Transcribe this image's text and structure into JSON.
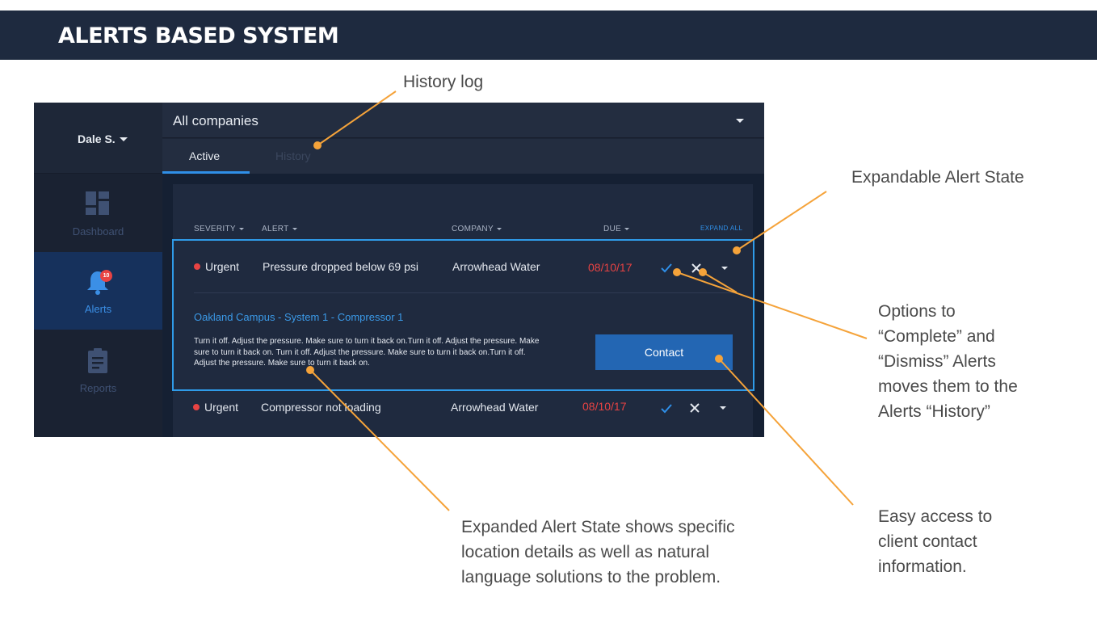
{
  "page_title": "ALERTS BASED SYSTEM",
  "app": {
    "user": {
      "name": "Dale S."
    },
    "nav": [
      {
        "label": "Dashboard",
        "icon": "dashboard-icon"
      },
      {
        "label": "Alerts",
        "icon": "bell-icon",
        "badge": "10"
      },
      {
        "label": "Reports",
        "icon": "clipboard-icon"
      }
    ],
    "company_select": "All companies",
    "tabs": [
      {
        "label": "Active",
        "selected": true
      },
      {
        "label": "History",
        "selected": false
      }
    ],
    "table": {
      "headers": [
        "SEVERITY",
        "ALERT",
        "COMPANY",
        "DUE"
      ],
      "expand_all": "EXPAND ALL",
      "rows": [
        {
          "severity": "Urgent",
          "alert": "Pressure dropped below 69 psi",
          "company": "Arrowhead Water",
          "due": "08/10/17",
          "expanded": true,
          "location": "Oakland Campus -  System 1 - Compressor 1",
          "solution": "Turn it off. Adjust the pressure. Make sure to turn it back on.Turn it off. Adjust the pressure. Make sure to turn it back on. Turn it off. Adjust the pressure. Make sure to turn it back on.Turn it off. Adjust the pressure. Make sure to turn it back on.",
          "contact_label": "Contact"
        },
        {
          "severity": "Urgent",
          "alert": "Compressor not loading",
          "company": "Arrowhead Water",
          "due": "08/10/17",
          "expanded": false
        }
      ]
    },
    "colors": {
      "accent": "#2f8fe8",
      "urgent": "#e84343",
      "panel": "#1f2a3f",
      "title_bar": "#1e2a3f"
    }
  },
  "annotations": {
    "history_log": "History log",
    "expandable": "Expandable Alert State",
    "options": [
      "Options to",
      "“Complete” and",
      "“Dismiss” Alerts",
      "moves them to the",
      "Alerts “History”"
    ],
    "expanded_state": [
      "Expanded Alert State shows specific",
      "location details as well as natural",
      "language solutions to the problem."
    ],
    "contact": [
      "Easy access to",
      "client contact",
      "information."
    ]
  },
  "annotation_color": "#f5a33a"
}
